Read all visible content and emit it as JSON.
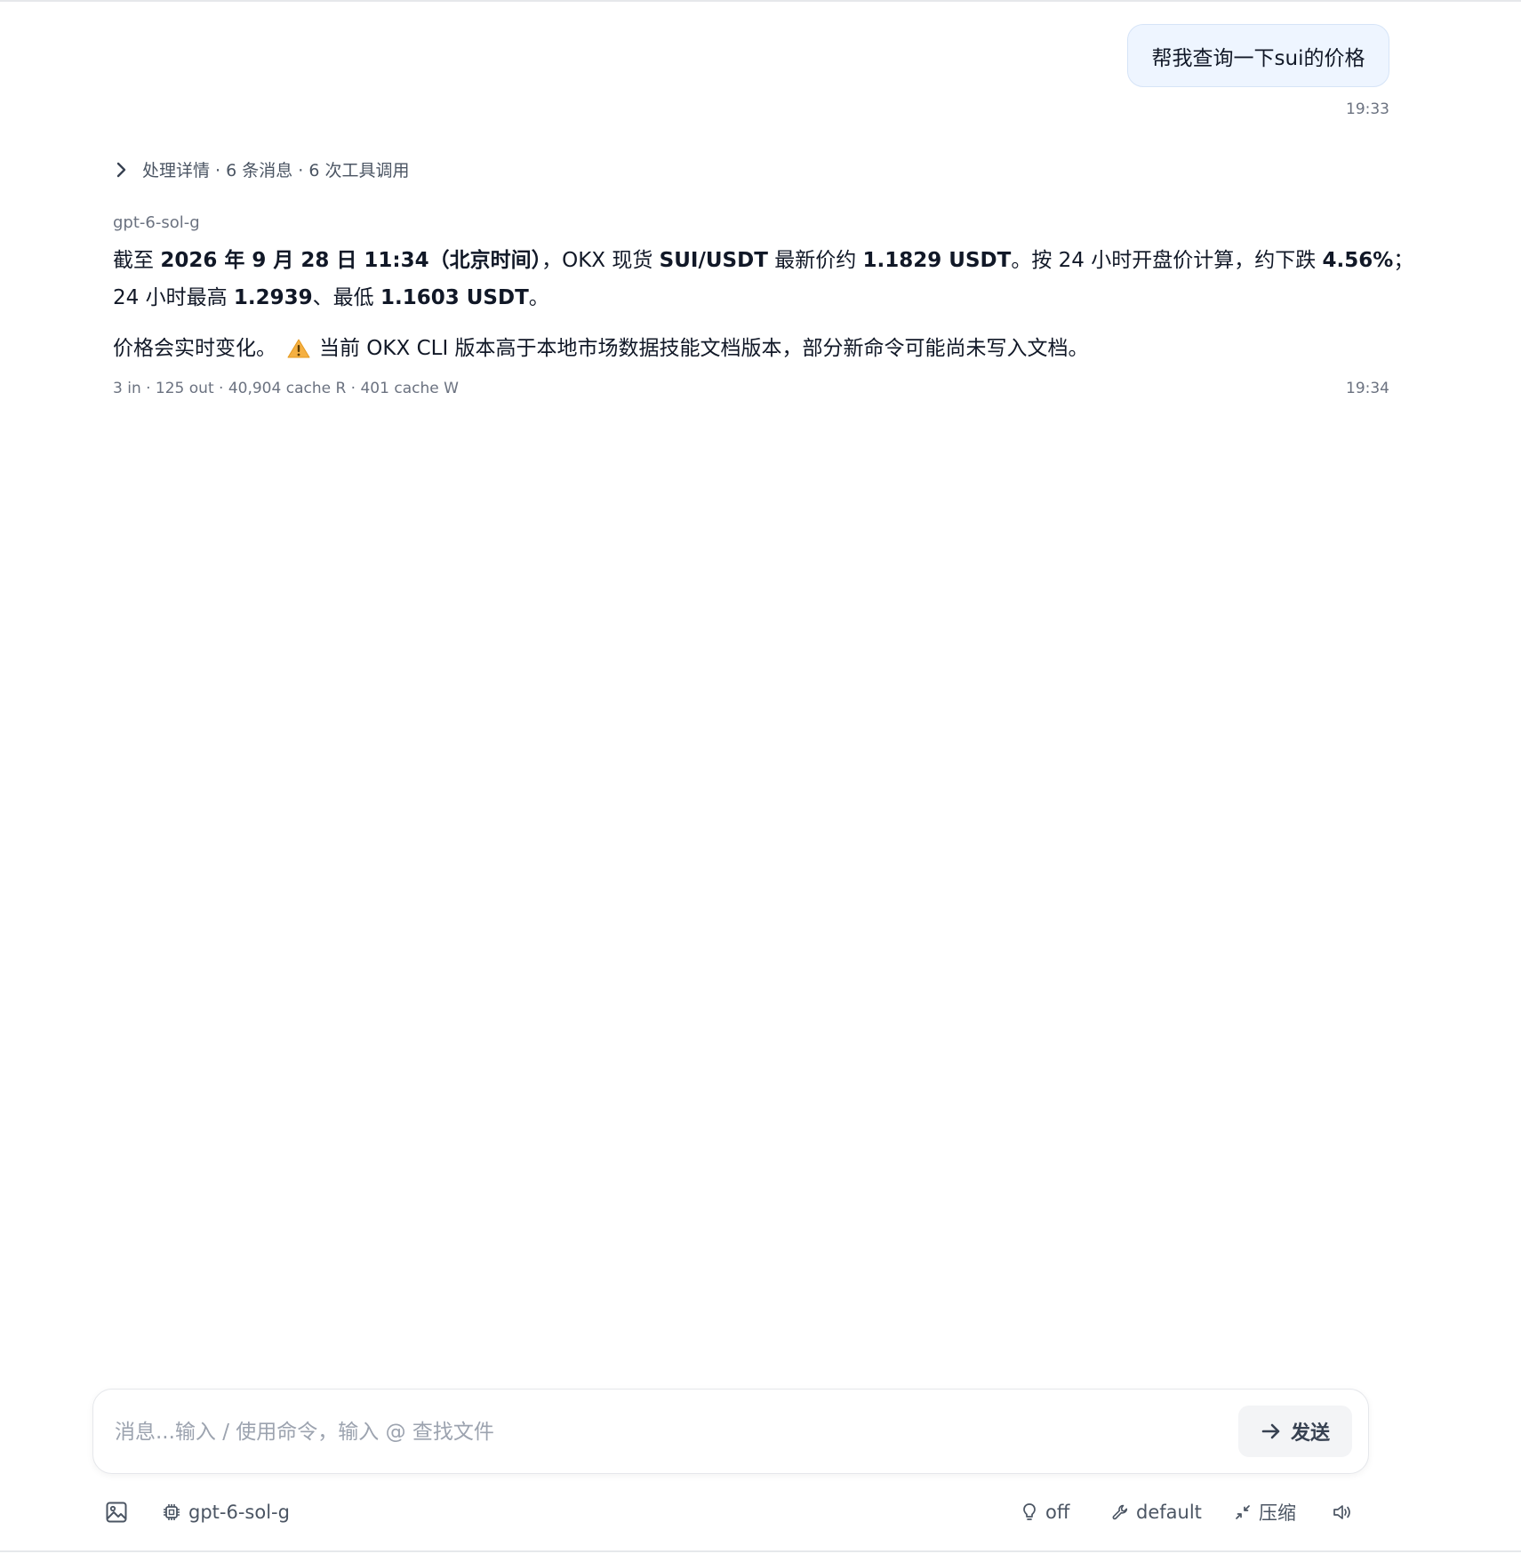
{
  "user_message": {
    "text": "帮我查询一下sui的价格",
    "time": "19:33"
  },
  "details": {
    "text": "处理详情 · 6 条消息 · 6 次工具调用"
  },
  "assistant": {
    "model": "gpt-6-sol-g",
    "line1": [
      {
        "t": "截至 ",
        "b": false
      },
      {
        "t": "2026 年 9 月 28 日 11:34（北京时间）",
        "b": true
      },
      {
        "t": "，OKX 现货 ",
        "b": false
      },
      {
        "t": "SUI/USDT",
        "b": true
      },
      {
        "t": " 最新价约 ",
        "b": false
      },
      {
        "t": "1.1829 USDT",
        "b": true
      },
      {
        "t": "。按 24 小时开盘价计算，约下跌 ",
        "b": false
      },
      {
        "t": "4.56%",
        "b": true
      },
      {
        "t": "；",
        "b": false
      }
    ],
    "line2": [
      {
        "t": "24 小时最高 ",
        "b": false
      },
      {
        "t": "1.2939",
        "b": true
      },
      {
        "t": "、最低 ",
        "b": false
      },
      {
        "t": "1.1603 USDT",
        "b": true
      },
      {
        "t": "。",
        "b": false
      }
    ],
    "note_prefix": "价格会实时变化。",
    "note_suffix": "当前 OKX CLI 版本高于本地市场数据技能文档版本，部分新命令可能尚未写入文档。",
    "usage": "3 in · 125 out · 40,904 cache R · 401 cache W",
    "time": "19:34"
  },
  "composer": {
    "placeholder": "消息...输入 / 使用命令，输入 @ 查找文件",
    "value": "",
    "send_label": "发送"
  },
  "toolbar": {
    "model_label": "gpt-6-sol-g",
    "thinking_label": "off",
    "permission_label": "default",
    "compress_label": "压缩"
  },
  "icons": {
    "image": "image-icon",
    "chip": "chip-icon",
    "bulb": "lightbulb-icon",
    "wrench": "wrench-icon",
    "compress": "compress-icon",
    "speaker": "speaker-icon",
    "warning": "warning-icon",
    "chevron": "chevron-right-icon",
    "arrow": "arrow-right-icon"
  },
  "colors": {
    "user_bubble_bg": "#eef5ff",
    "warning": "#f5a623"
  }
}
